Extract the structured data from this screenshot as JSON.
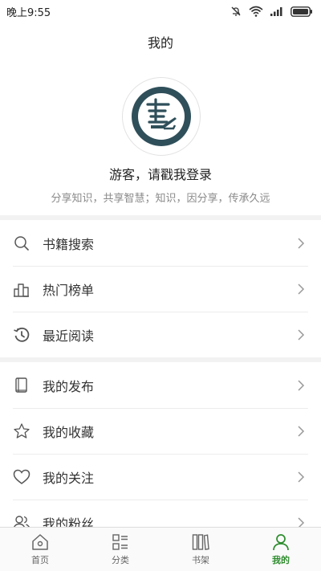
{
  "status_bar": {
    "time": "晚上9:55"
  },
  "header": {
    "title": "我的"
  },
  "profile": {
    "login_text": "游客，请戳我登录",
    "slogan": "分享知识，共享智慧；知识，因分享，传承久远"
  },
  "menu_group_1": [
    {
      "label": "书籍搜索",
      "icon": "search-icon"
    },
    {
      "label": "热门榜单",
      "icon": "ranking-icon"
    },
    {
      "label": "最近阅读",
      "icon": "history-icon"
    }
  ],
  "menu_group_2": [
    {
      "label": "我的发布",
      "icon": "book-icon"
    },
    {
      "label": "我的收藏",
      "icon": "star-icon"
    },
    {
      "label": "我的关注",
      "icon": "heart-icon"
    },
    {
      "label": "我的粉丝",
      "icon": "users-icon"
    }
  ],
  "bottom_nav": [
    {
      "label": "首页",
      "icon": "home-icon",
      "active": false
    },
    {
      "label": "分类",
      "icon": "category-icon",
      "active": false
    },
    {
      "label": "书架",
      "icon": "bookshelf-icon",
      "active": false
    },
    {
      "label": "我的",
      "icon": "profile-icon",
      "active": true
    }
  ],
  "colors": {
    "accent": "#2d8c2d",
    "logo": "#2f4f5a",
    "divider": "#ececec",
    "section_gap": "#f2f2f2"
  }
}
